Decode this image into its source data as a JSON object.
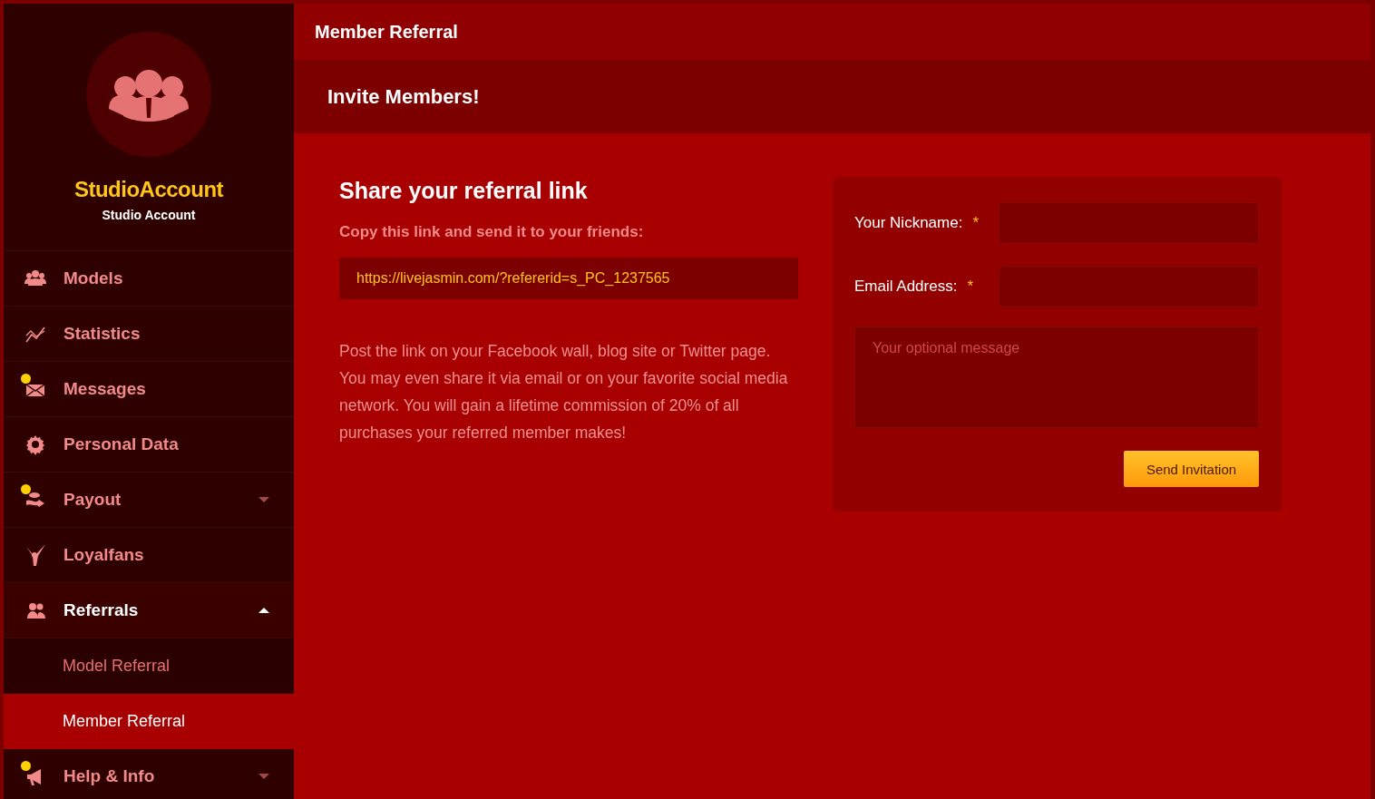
{
  "profile": {
    "name": "StudioAccount",
    "subtitle": "Studio Account"
  },
  "nav": [
    {
      "kind": "models",
      "label": "Models",
      "badge": false,
      "selected": false
    },
    {
      "kind": "statistics",
      "label": "Statistics",
      "badge": false,
      "selected": false
    },
    {
      "kind": "messages",
      "label": "Messages",
      "badge": true,
      "selected": false
    },
    {
      "kind": "settings",
      "label": "Personal Data",
      "badge": false,
      "selected": false
    },
    {
      "kind": "payout",
      "label": "Payout",
      "badge": true,
      "selected": false,
      "expanded": false
    },
    {
      "kind": "loyalfans",
      "label": "Loyalfans",
      "badge": false,
      "selected": false
    },
    {
      "kind": "referrals",
      "label": "Referrals",
      "badge": false,
      "selected": true,
      "expanded": true,
      "children": [
        {
          "label": "Model Referral",
          "selected": false
        },
        {
          "label": "Member Referral",
          "selected": true
        }
      ]
    },
    {
      "kind": "help",
      "label": "Help & Info",
      "badge": true,
      "selected": false,
      "expanded": false
    }
  ],
  "header": {
    "title": "Member Referral"
  },
  "banner": {
    "title": "Invite Members!"
  },
  "share": {
    "title": "Share your referral link",
    "instruction": "Copy this link and send it to your friends:",
    "link": "https://livejasmin.com/?refererid=s_PC_1237565",
    "description": "Post the link on your Facebook wall, blog site or Twitter page. You may even share it via email or on your favorite social media network. You will gain a lifetime commission of 20% of all purchases your referred member makes!"
  },
  "form": {
    "fields": [
      {
        "label": "Your Nickname:",
        "required_mark": "*"
      },
      {
        "label": "Email Address:",
        "required_mark": "*"
      }
    ],
    "message": {
      "placeholder": "Your optional message"
    },
    "button": "Send Invitation"
  }
}
